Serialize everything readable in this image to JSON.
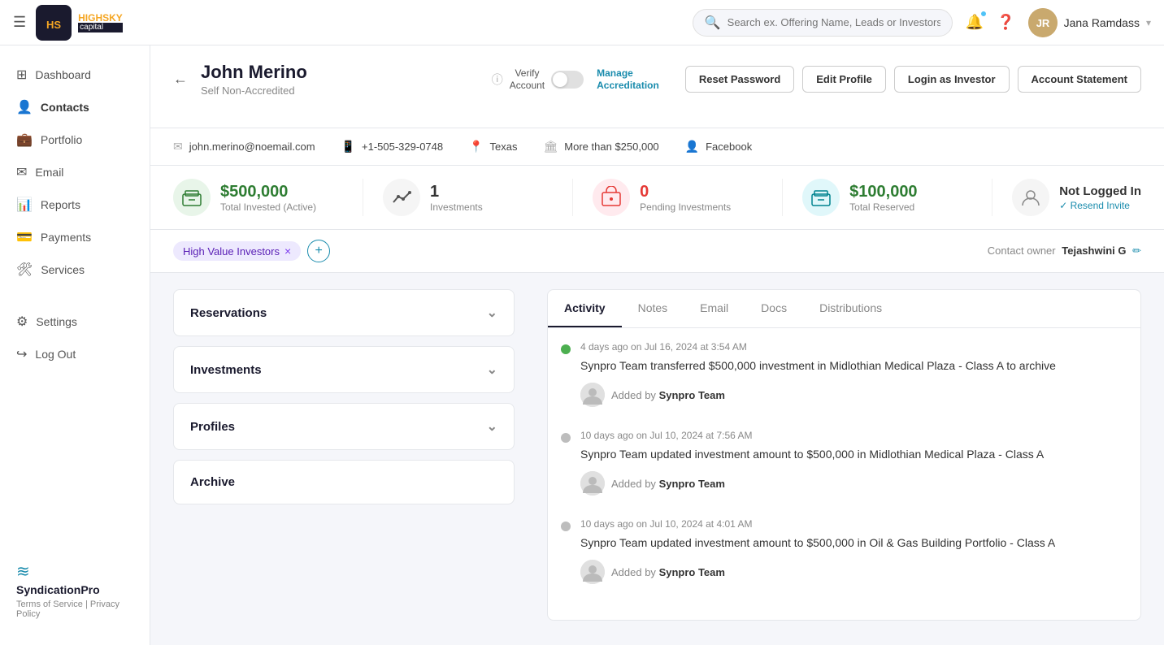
{
  "app": {
    "menu_icon": "☰",
    "logo_text": "HIGHSKY\ncapital",
    "logo_abbr": "HS"
  },
  "topnav": {
    "search_placeholder": "Search ex. Offering Name, Leads or Investors",
    "username": "Jana Ramdass",
    "avatar_initials": "JR"
  },
  "sidebar": {
    "items": [
      {
        "id": "dashboard",
        "label": "Dashboard",
        "icon": "⊞"
      },
      {
        "id": "contacts",
        "label": "Contacts",
        "icon": "👤",
        "active": true
      },
      {
        "id": "portfolio",
        "label": "Portfolio",
        "icon": "💼"
      },
      {
        "id": "email",
        "label": "Email",
        "icon": "✉"
      },
      {
        "id": "reports",
        "label": "Reports",
        "icon": "📊"
      },
      {
        "id": "payments",
        "label": "Payments",
        "icon": "💳"
      },
      {
        "id": "services",
        "label": "Services",
        "icon": "⚙"
      },
      {
        "id": "settings",
        "label": "Settings",
        "icon": "⚙"
      },
      {
        "id": "logout",
        "label": "Log Out",
        "icon": "↪"
      }
    ],
    "logo_bottom": "SyndicationPro",
    "terms": "Terms of Service",
    "privacy": "Privacy Policy"
  },
  "profile": {
    "name": "John Merino",
    "subtitle": "Self Non-Accredited",
    "verify_label": "Verify\nAccount",
    "manage_accred": "Manage\nAccreditation",
    "buttons": {
      "reset_password": "Reset Password",
      "edit_profile": "Edit Profile",
      "login_as_investor": "Login as Investor",
      "account_statement": "Account Statement"
    }
  },
  "contact_info": {
    "email": "john.merino@noemail.com",
    "phone": "+1-505-329-0748",
    "location": "Texas",
    "income": "More than $250,000",
    "source": "Facebook"
  },
  "stats": [
    {
      "id": "total-invested",
      "value": "$500,000",
      "label": "Total Invested (Active)",
      "color": "green",
      "icon": "🏦"
    },
    {
      "id": "investments",
      "value": "1",
      "label": "Investments",
      "color": "gray",
      "icon": "📈"
    },
    {
      "id": "pending",
      "value": "0",
      "label": "Pending Investments",
      "color": "red",
      "icon": "🏢"
    },
    {
      "id": "reserved",
      "value": "$100,000",
      "label": "Total Reserved",
      "color": "green",
      "icon": "🏦"
    },
    {
      "id": "login-status",
      "value": "Not Logged In",
      "label": "Resend Invite",
      "color": "gray",
      "icon": "👤"
    }
  ],
  "tags": {
    "items": [
      "High Value Investors"
    ],
    "contact_owner_label": "Contact owner",
    "contact_owner_name": "Tejashwini G"
  },
  "left_panel": {
    "sections": [
      {
        "id": "reservations",
        "label": "Reservations",
        "expanded": false
      },
      {
        "id": "investments",
        "label": "Investments",
        "expanded": false
      },
      {
        "id": "profiles",
        "label": "Profiles",
        "expanded": false
      },
      {
        "id": "archive",
        "label": "Archive",
        "expanded": false
      }
    ]
  },
  "tabs": [
    {
      "id": "activity",
      "label": "Activity",
      "active": true
    },
    {
      "id": "notes",
      "label": "Notes",
      "active": false
    },
    {
      "id": "email",
      "label": "Email",
      "active": false
    },
    {
      "id": "docs",
      "label": "Docs",
      "active": false
    },
    {
      "id": "distributions",
      "label": "Distributions",
      "active": false
    }
  ],
  "activity": [
    {
      "id": "act1",
      "time": "4 days ago on Jul 16, 2024 at 3:54 AM",
      "text": "Synpro Team transferred $500,000 investment in Midlothian Medical Plaza - Class A to archive",
      "added_by": "Synpro Team",
      "dot_color": "green"
    },
    {
      "id": "act2",
      "time": "10 days ago on Jul 10, 2024 at 7:56 AM",
      "text": "Synpro Team updated investment amount to $500,000 in Midlothian Medical Plaza - Class A",
      "added_by": "Synpro Team",
      "dot_color": "gray"
    },
    {
      "id": "act3",
      "time": "10 days ago on Jul 10, 2024 at 4:01 AM",
      "text": "Synpro Team updated investment amount to $500,000 in Oil & Gas Building Portfolio - Class A",
      "added_by": "Synpro Team",
      "dot_color": "gray"
    }
  ],
  "labels": {
    "added_by": "Added by"
  }
}
